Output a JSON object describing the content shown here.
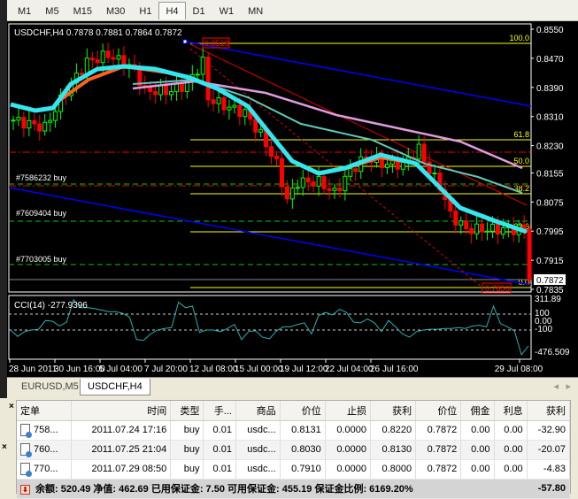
{
  "timeframes": [
    "M1",
    "M5",
    "M15",
    "M30",
    "H1",
    "H4",
    "D1",
    "W1",
    "MN"
  ],
  "active_timeframe": "H4",
  "chart": {
    "header": "USDCHF,H4  0.7878 0.7881 0.7864 0.7872",
    "price_labels": [
      "0.8550",
      "0.8470",
      "0.8390",
      "0.8310",
      "0.8230",
      "0.8155",
      "0.8075",
      "0.7995",
      "0.7915",
      "0.7835"
    ],
    "current_price": "0.7872",
    "fib_labels": [
      "100.0",
      "61.8",
      "50.0",
      "38.2",
      "23.6",
      "0.0"
    ],
    "fib_high": "0.8519",
    "fib_low": "0.7850",
    "order_labels": [
      "#7586232 buy",
      "#7609404 buy",
      "#7703005 buy"
    ],
    "price_keypoints": [
      [
        0,
        0.83
      ],
      [
        6,
        0.828
      ],
      [
        10,
        0.838
      ],
      [
        14,
        0.846
      ],
      [
        18,
        0.848
      ],
      [
        23,
        0.844
      ],
      [
        25,
        0.838
      ],
      [
        30,
        0.838
      ],
      [
        33,
        0.84
      ],
      [
        36,
        0.846
      ],
      [
        37,
        0.836
      ],
      [
        40,
        0.834
      ],
      [
        44,
        0.832
      ],
      [
        47,
        0.826
      ],
      [
        50,
        0.818
      ],
      [
        52,
        0.808
      ],
      [
        54,
        0.813
      ],
      [
        58,
        0.813
      ],
      [
        61,
        0.81
      ],
      [
        64,
        0.816
      ],
      [
        67,
        0.82
      ],
      [
        70,
        0.818
      ],
      [
        74,
        0.818
      ],
      [
        77,
        0.822
      ],
      [
        79,
        0.816
      ],
      [
        81,
        0.812
      ],
      [
        83,
        0.804
      ],
      [
        86,
        0.8
      ],
      [
        90,
        0.8
      ],
      [
        94,
        0.8
      ],
      [
        97,
        0.8
      ],
      [
        98,
        0.7872
      ]
    ],
    "cci_label": "CCI(14) -277.9396",
    "cci_axis": [
      "311.89",
      "100",
      "0.00",
      "-100",
      "-476.509"
    ],
    "cci_values": [
      -100,
      -180,
      -120,
      -100,
      -90,
      20,
      10,
      -50,
      0,
      280,
      180,
      180,
      170,
      150,
      130,
      130,
      110,
      60,
      -220,
      -230,
      -150,
      -100,
      -80,
      -70,
      250,
      180,
      200,
      -130,
      -100,
      -100,
      -120,
      -80,
      -30,
      -220,
      -120,
      -110,
      -190,
      -210,
      -110,
      -60,
      -60,
      -30,
      -10,
      -150,
      80,
      120,
      90,
      160,
      120,
      0,
      -10,
      40,
      -10,
      -120,
      20,
      -60,
      -150,
      -190,
      -120,
      -100,
      -90,
      -90,
      -80,
      -80,
      -70,
      -80,
      -50,
      -40,
      -60,
      200,
      -20,
      -60,
      -110,
      -410,
      -300
    ],
    "time_labels": [
      "28 Jun 2011",
      "30 Jun 16:00",
      "5 Jul 04:00",
      "7 Jul 20:00",
      "12 Jul 08:00",
      "15 Jul 00:00",
      "19 Jul 12:00",
      "22 Jul 04:00",
      "26 Jul 16:00",
      "29 Jul 08:00"
    ]
  },
  "chart_tabs": [
    "EURUSD,M5",
    "USDCHF,H4"
  ],
  "terminal": {
    "headers": [
      "定单",
      "时间",
      "类型",
      "手...",
      "商品",
      "价位",
      "止损",
      "获利",
      "价位",
      "佣金",
      "利息",
      "获利"
    ],
    "rows": [
      [
        "758...",
        "2011.07.24 17:16",
        "buy",
        "0.01",
        "usdc...",
        "0.8131",
        "0.0000",
        "0.8220",
        "0.7872",
        "0.00",
        "0.00",
        "-32.90"
      ],
      [
        "760...",
        "2011.07.25 21:04",
        "buy",
        "0.01",
        "usdc...",
        "0.8030",
        "0.0000",
        "0.8130",
        "0.7872",
        "0.00",
        "0.00",
        "-20.07"
      ],
      [
        "770...",
        "2011.07.29 08:50",
        "buy",
        "0.01",
        "usdc...",
        "0.7910",
        "0.0000",
        "0.8000",
        "0.7872",
        "0.00",
        "0.00",
        "-4.83"
      ]
    ],
    "summary": "余额: 520.49  净值: 462.69  已用保证金: 7.50  可用保证金: 455.19  保证金比例: 6169.20%",
    "summary_total": "-57.80"
  }
}
